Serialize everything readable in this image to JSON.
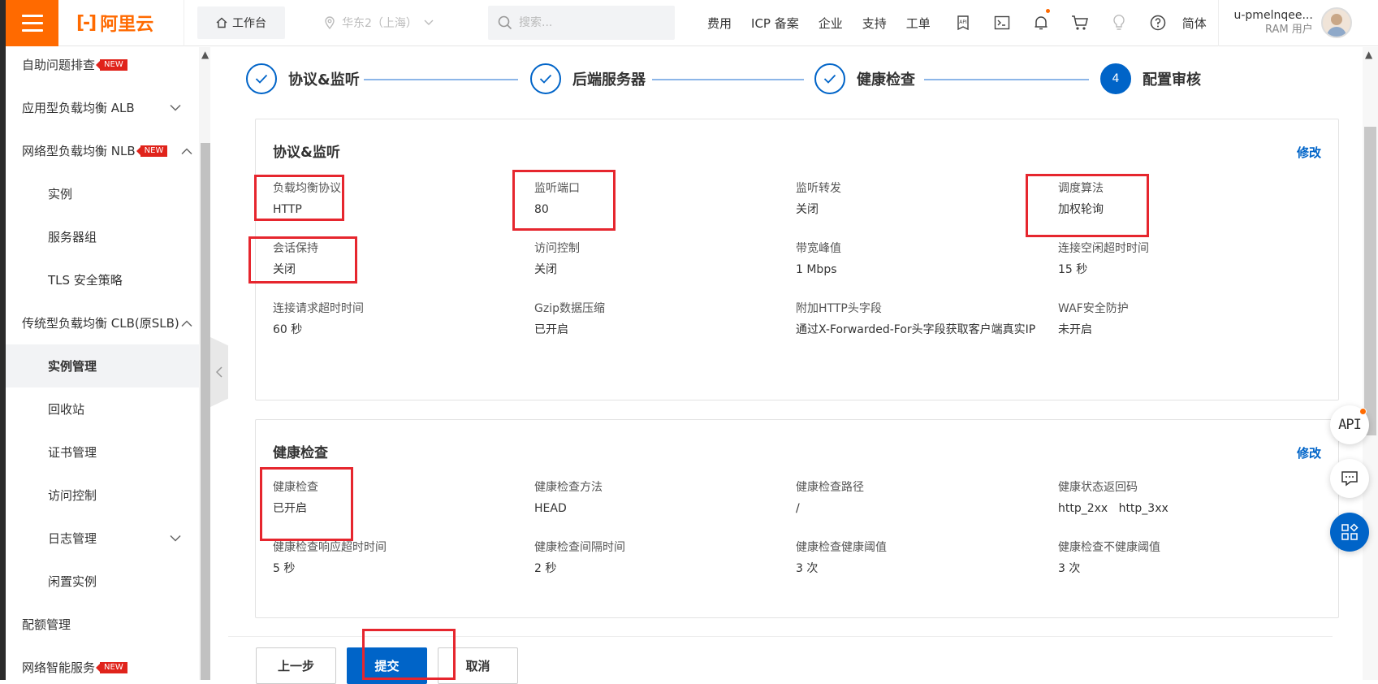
{
  "topbar": {
    "logo_mark": "[-]",
    "logo_text": "阿里云",
    "workbench": "工作台",
    "region": "华东2（上海）",
    "search_placeholder": "搜索...",
    "links": [
      "费用",
      "ICP 备案",
      "企业",
      "支持",
      "工单"
    ],
    "lang": "简体",
    "user_name": "u-pmelnqee...",
    "user_role": "RAM 用户"
  },
  "sidebar": {
    "new_badge": "NEW",
    "items": [
      {
        "label": "自助问题排查",
        "badge": true
      },
      {
        "label": "应用型负载均衡 ALB",
        "chevron": "down"
      },
      {
        "label": "网络型负载均衡 NLB",
        "badge": true,
        "chevron": "up"
      },
      {
        "label": "实例",
        "sub": true
      },
      {
        "label": "服务器组",
        "sub": true
      },
      {
        "label": "TLS 安全策略",
        "sub": true
      },
      {
        "label": "传统型负载均衡 CLB(原SLB)",
        "chevron": "up"
      },
      {
        "label": "实例管理",
        "sub": true,
        "active": true
      },
      {
        "label": "回收站",
        "sub": true
      },
      {
        "label": "证书管理",
        "sub": true
      },
      {
        "label": "访问控制",
        "sub": true
      },
      {
        "label": "日志管理",
        "sub": true,
        "chevron": "down"
      },
      {
        "label": "闲置实例",
        "sub": true
      },
      {
        "label": "配额管理"
      },
      {
        "label": "网络智能服务",
        "badge": true
      }
    ]
  },
  "steps": [
    {
      "label": "协议&监听",
      "state": "done"
    },
    {
      "label": "后端服务器",
      "state": "done"
    },
    {
      "label": "健康检查",
      "state": "done"
    },
    {
      "label": "配置审核",
      "state": "current",
      "number": "4"
    }
  ],
  "listener_card": {
    "title": "协议&监听",
    "edit": "修改",
    "fields": [
      {
        "label": "负载均衡协议",
        "value": "HTTP"
      },
      {
        "label": "监听端口",
        "value": "80"
      },
      {
        "label": "监听转发",
        "value": "关闭"
      },
      {
        "label": "调度算法",
        "value": "加权轮询"
      },
      {
        "label": "会话保持",
        "value": "关闭"
      },
      {
        "label": "访问控制",
        "value": "关闭"
      },
      {
        "label": "带宽峰值",
        "value": "1 Mbps"
      },
      {
        "label": "连接空闲超时时间",
        "value": "15 秒"
      },
      {
        "label": "连接请求超时时间",
        "value": "60 秒"
      },
      {
        "label": "Gzip数据压缩",
        "value": "已开启"
      },
      {
        "label": "附加HTTP头字段",
        "value": "通过X-Forwarded-For头字段获取客户端真实IP"
      },
      {
        "label": "WAF安全防护",
        "value": "未开启"
      }
    ]
  },
  "health_card": {
    "title": "健康检查",
    "edit": "修改",
    "fields": [
      {
        "label": "健康检查",
        "value": "已开启"
      },
      {
        "label": "健康检查方法",
        "value": "HEAD"
      },
      {
        "label": "健康检查路径",
        "value": "/"
      },
      {
        "label": "健康状态返回码",
        "value": "http_2xx   http_3xx"
      },
      {
        "label": "健康检查响应超时时间",
        "value": "5 秒"
      },
      {
        "label": "健康检查间隔时间",
        "value": "2 秒"
      },
      {
        "label": "健康检查健康阈值",
        "value": "3 次"
      },
      {
        "label": "健康检查不健康阈值",
        "value": "3 次"
      }
    ]
  },
  "actions": {
    "prev": "上一步",
    "submit": "提交",
    "cancel": "取消"
  },
  "floating": {
    "api": "API"
  },
  "colors": {
    "brand": "#ff6a00",
    "primary": "#0064c8",
    "highlight": "#e6262e"
  }
}
